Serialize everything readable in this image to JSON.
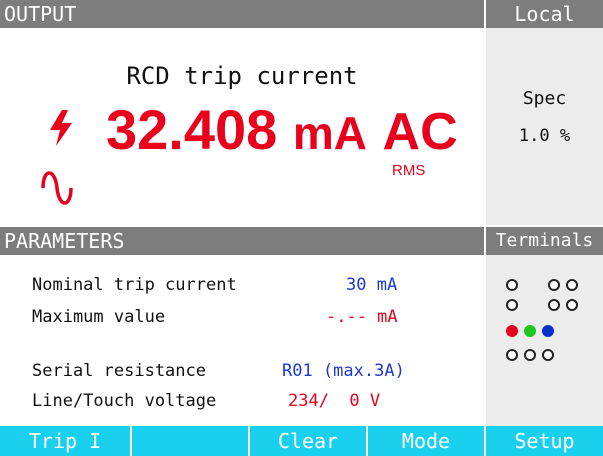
{
  "output": {
    "header": "OUTPUT",
    "function_title": "RCD trip current",
    "value": "32.408",
    "unit": "mA",
    "mode": "AC",
    "sub_label": "RMS",
    "icons": [
      "lightning-icon",
      "sine-wave-icon"
    ]
  },
  "local": {
    "header": "Local",
    "spec_label": "Spec",
    "spec_value": "1.0 %"
  },
  "parameters": {
    "header": "PARAMETERS",
    "rows": [
      {
        "label": "Nominal trip current",
        "value": "30 mA"
      },
      {
        "label": "Maximum value",
        "value": "-.-- mA"
      },
      {
        "label": "Serial resistance",
        "value": "R01 (max.3A)"
      },
      {
        "label": "Line/Touch voltage",
        "value": "234/  0 V"
      }
    ]
  },
  "terminals": {
    "header": "Terminals",
    "indicator_colors": {
      "red": "#e8001c",
      "green": "#1ec81e",
      "blue": "#0b2ecf"
    }
  },
  "softkeys": [
    {
      "label": "Trip I"
    },
    {
      "label": ""
    },
    {
      "label": "Clear"
    },
    {
      "label": "Mode"
    },
    {
      "label": "Setup"
    }
  ],
  "colors": {
    "header_bg": "#7d7d7d",
    "panel_bg": "#f2f2f2",
    "accent_red": "#e8001c",
    "accent_blue": "#1f39d6",
    "softkey_bg": "#1ad0ef"
  }
}
